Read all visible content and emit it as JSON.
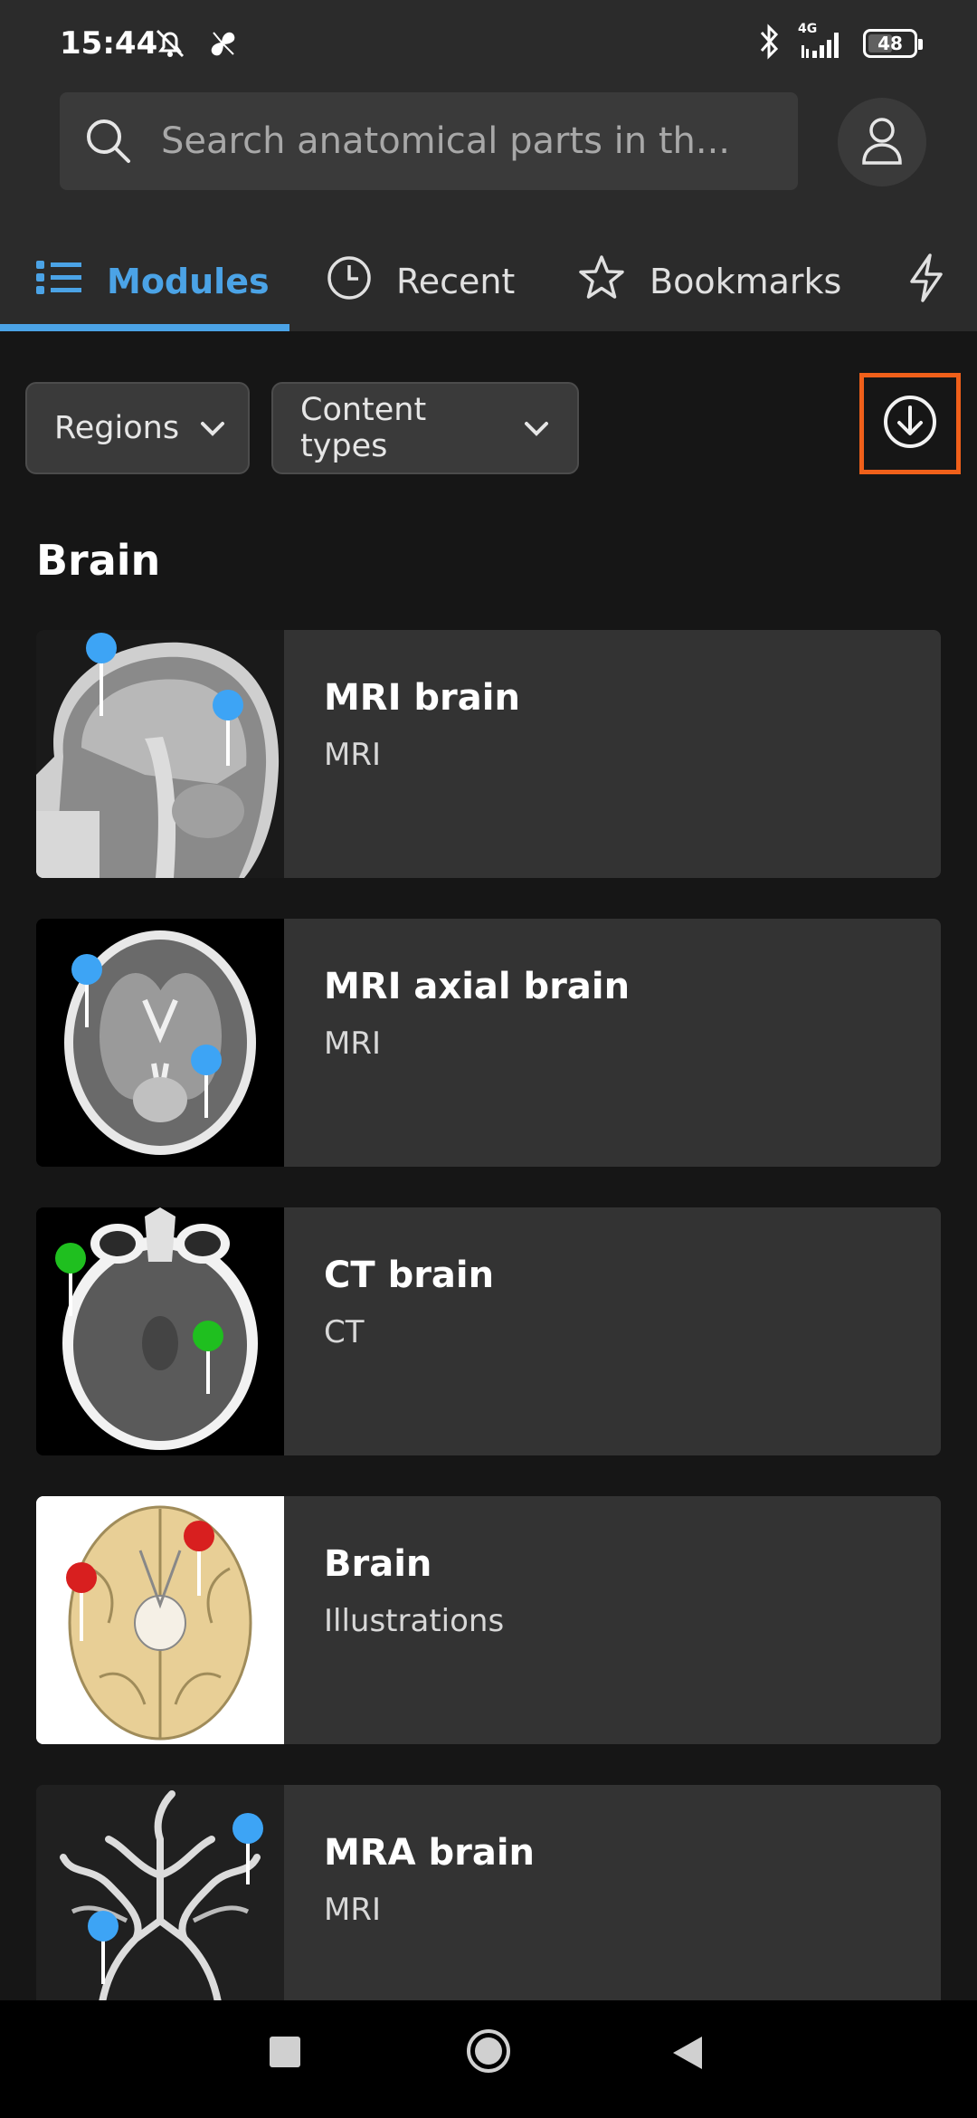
{
  "status_bar": {
    "time": "15:44",
    "network": "4G",
    "battery": "48"
  },
  "search": {
    "placeholder": "Search anatomical parts in th..."
  },
  "tabs": [
    {
      "label": "Modules",
      "icon": "list-icon",
      "active": true
    },
    {
      "label": "Recent",
      "icon": "clock-icon",
      "active": false
    },
    {
      "label": "Bookmarks",
      "icon": "star-icon",
      "active": false
    },
    {
      "label": "",
      "icon": "lightning-icon",
      "active": false
    }
  ],
  "filters": {
    "regions_label": "Regions",
    "content_types_label": "Content types"
  },
  "section": {
    "title": "Brain"
  },
  "modules": [
    {
      "title": "MRI brain",
      "subtitle": "MRI"
    },
    {
      "title": "MRI axial brain",
      "subtitle": "MRI"
    },
    {
      "title": "CT brain",
      "subtitle": "CT"
    },
    {
      "title": "Brain",
      "subtitle": "Illustrations"
    },
    {
      "title": "MRA brain",
      "subtitle": "MRI"
    }
  ],
  "colors": {
    "accent": "#4ba3e6",
    "highlight": "#f0601a",
    "pin_blue": "#3da4f5",
    "pin_green": "#1fbf1f",
    "pin_red": "#d81f1f"
  }
}
